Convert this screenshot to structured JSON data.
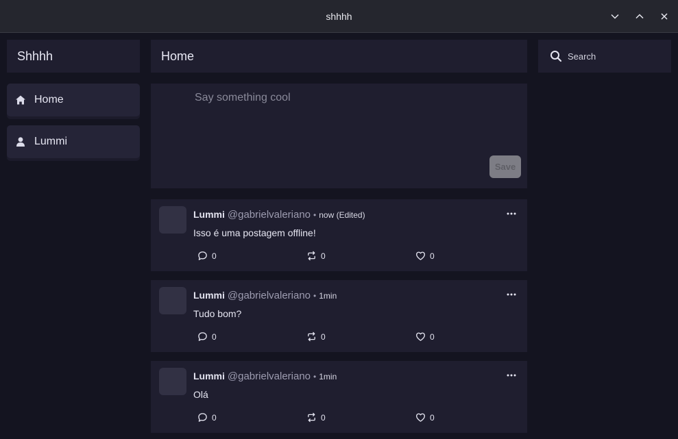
{
  "window": {
    "title": "shhhh",
    "controls": [
      "chevron-down-icon",
      "chevron-up-icon",
      "close-icon"
    ]
  },
  "sidebar": {
    "brand": "Shhhh",
    "items": [
      {
        "label": "Home",
        "icon": "home-icon"
      },
      {
        "label": "Lummi",
        "icon": "user-icon"
      }
    ]
  },
  "main": {
    "title": "Home",
    "composer": {
      "placeholder": "Say something cool",
      "value": "",
      "save_label": "Save"
    },
    "posts": [
      {
        "name": "Lummi",
        "handle": "@gabrielvaleriano",
        "separator": "•",
        "time": "now (Edited)",
        "text": "Isso é uma postagem offline!",
        "replies": "0",
        "reposts": "0",
        "likes": "0"
      },
      {
        "name": "Lummi",
        "handle": "@gabrielvaleriano",
        "separator": "•",
        "time": "1min",
        "text": "Tudo bom?",
        "replies": "0",
        "reposts": "0",
        "likes": "0"
      },
      {
        "name": "Lummi",
        "handle": "@gabrielvaleriano",
        "separator": "•",
        "time": "1min",
        "text": "Olá",
        "replies": "0",
        "reposts": "0",
        "likes": "0"
      }
    ]
  },
  "search": {
    "placeholder": "Search",
    "value": ""
  },
  "colors": {
    "background": "#141420",
    "panel": "#1f1e2f",
    "titlebar": "#25262e",
    "save_button": "#7d7d85"
  }
}
